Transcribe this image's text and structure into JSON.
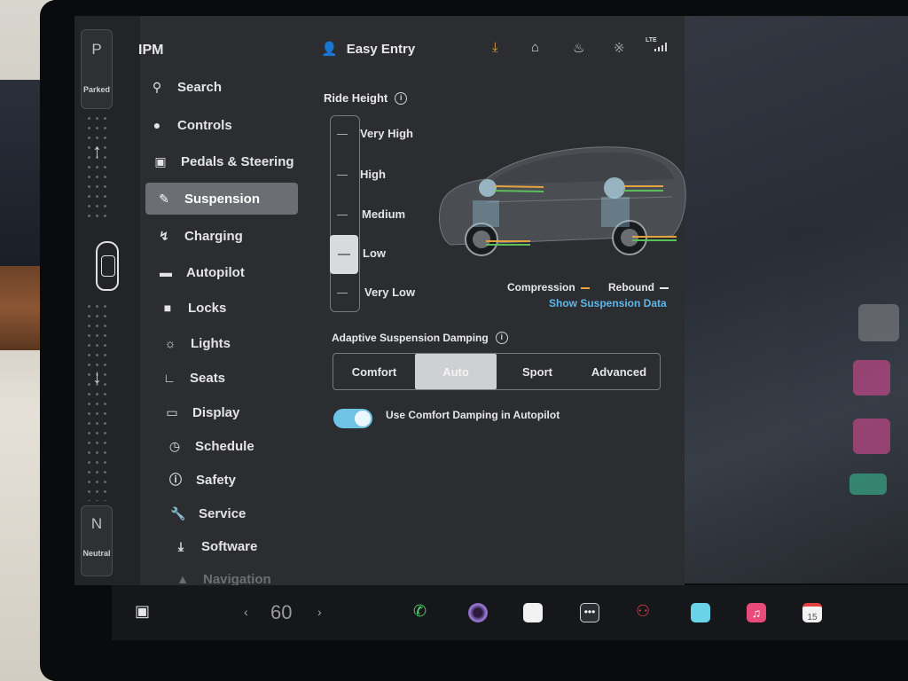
{
  "gear": {
    "park_letter": "P",
    "park_label": "Parked",
    "neutral_letter": "N",
    "neutral_label": "Neutral"
  },
  "sidebar": {
    "title": "IPM",
    "items": [
      {
        "label": "Search",
        "icon": "search-icon"
      },
      {
        "label": "Controls",
        "icon": "toggle-icon"
      },
      {
        "label": "Pedals & Steering",
        "icon": "car-icon"
      },
      {
        "label": "Suspension",
        "icon": "suspension-icon",
        "active": true
      },
      {
        "label": "Charging",
        "icon": "lightning-icon"
      },
      {
        "label": "Autopilot",
        "icon": "steering-icon"
      },
      {
        "label": "Locks",
        "icon": "lock-icon"
      },
      {
        "label": "Lights",
        "icon": "sun-icon"
      },
      {
        "label": "Seats",
        "icon": "seat-icon"
      },
      {
        "label": "Display",
        "icon": "display-icon"
      },
      {
        "label": "Schedule",
        "icon": "clock-icon"
      },
      {
        "label": "Safety",
        "icon": "alert-icon"
      },
      {
        "label": "Service",
        "icon": "wrench-icon"
      },
      {
        "label": "Software",
        "icon": "download-icon"
      },
      {
        "label": "Navigation",
        "icon": "navigation-icon"
      }
    ]
  },
  "topbar": {
    "profile_label": "Easy Entry",
    "network_label": "LTE",
    "accent_color": "#e4a340"
  },
  "ride_height": {
    "title": "Ride Height",
    "levels": [
      "Very High",
      "High",
      "Medium",
      "Low",
      "Very Low"
    ],
    "selected": "Low"
  },
  "suspension_legend": {
    "compression": "Compression",
    "rebound": "Rebound",
    "link": "Show Suspension Data"
  },
  "damping": {
    "title": "Adaptive Suspension Damping",
    "options": [
      "Comfort",
      "Auto",
      "Sport",
      "Advanced"
    ],
    "selected": "Auto",
    "toggle_label": "Use Comfort Damping in Autopilot",
    "toggle_on": true,
    "toggle_color": "#6fc4e6"
  },
  "dock": {
    "speed": "60",
    "calendar_day": "15"
  }
}
